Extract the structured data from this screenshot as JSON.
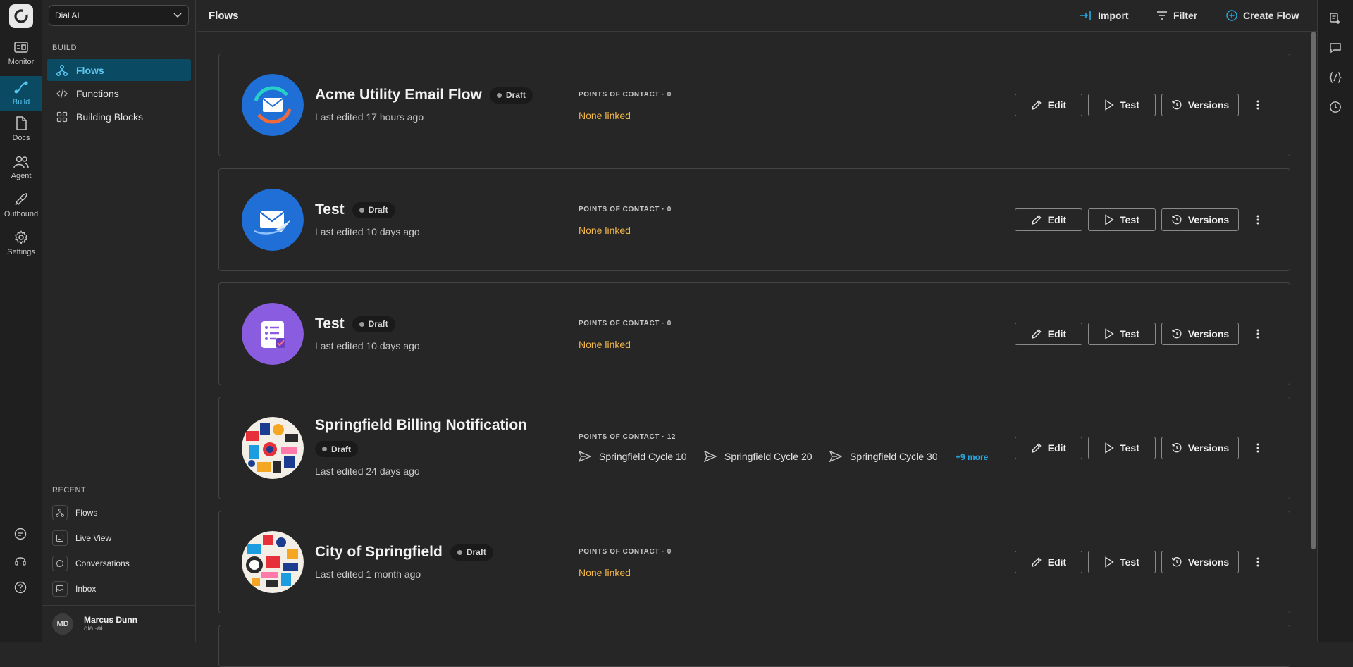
{
  "workspace": {
    "name": "Dial AI"
  },
  "rail": {
    "items": [
      {
        "label": "Monitor",
        "icon": "monitor-icon"
      },
      {
        "label": "Build",
        "icon": "build-icon"
      },
      {
        "label": "Docs",
        "icon": "docs-icon"
      },
      {
        "label": "Agent",
        "icon": "agent-icon"
      },
      {
        "label": "Outbound",
        "icon": "outbound-icon"
      },
      {
        "label": "Settings",
        "icon": "settings-icon"
      }
    ],
    "active": "Build"
  },
  "sidebar": {
    "section": "BUILD",
    "items": [
      {
        "label": "Flows",
        "icon": "flows-icon"
      },
      {
        "label": "Functions",
        "icon": "code-icon"
      },
      {
        "label": "Building Blocks",
        "icon": "blocks-icon"
      }
    ],
    "active": "Flows",
    "recent_label": "RECENT",
    "recent": [
      {
        "label": "Flows"
      },
      {
        "label": "Live View"
      },
      {
        "label": "Conversations"
      },
      {
        "label": "Inbox"
      }
    ]
  },
  "user": {
    "initials": "MD",
    "name": "Marcus Dunn",
    "org": "dial-ai"
  },
  "header": {
    "title": "Flows",
    "import_label": "Import",
    "filter_label": "Filter",
    "create_label": "Create Flow"
  },
  "buttons": {
    "edit": "Edit",
    "test": "Test",
    "versions": "Versions"
  },
  "flows": [
    {
      "title": "Acme Utility Email Flow",
      "status": "Draft",
      "edited": "Last edited 17 hours ago",
      "poc_label": "POINTS OF CONTACT · 0",
      "none_linked": "None linked",
      "avatar": "email-sync-avatar"
    },
    {
      "title": "Test",
      "status": "Draft",
      "edited": "Last edited 10 days ago",
      "poc_label": "POINTS OF CONTACT · 0",
      "none_linked": "None linked",
      "avatar": "email-plane-avatar"
    },
    {
      "title": "Test",
      "status": "Draft",
      "edited": "Last edited 10 days ago",
      "poc_label": "POINTS OF CONTACT · 0",
      "none_linked": "None linked",
      "avatar": "checklist-avatar"
    },
    {
      "title": "Springfield Billing Notification",
      "status": "Draft",
      "edited": "Last edited 24 days ago",
      "poc_label": "POINTS OF CONTACT · 12",
      "contacts": [
        "Springfield Cycle 10",
        "Springfield Cycle 20",
        "Springfield Cycle 30"
      ],
      "more": "+9 more",
      "avatar": "collage-avatar"
    },
    {
      "title": "City of Springfield",
      "status": "Draft",
      "edited": "Last edited 1 month ago",
      "poc_label": "POINTS OF CONTACT · 0",
      "none_linked": "None linked",
      "avatar": "collage-avatar-2"
    }
  ],
  "colors": {
    "accent": "#0b4a63",
    "accent_text": "#5ec9f2",
    "warning": "#f2b74a",
    "link": "#27a9e0",
    "avatar_blue": "#1f6fd6",
    "avatar_purple": "#8a5ce0"
  }
}
